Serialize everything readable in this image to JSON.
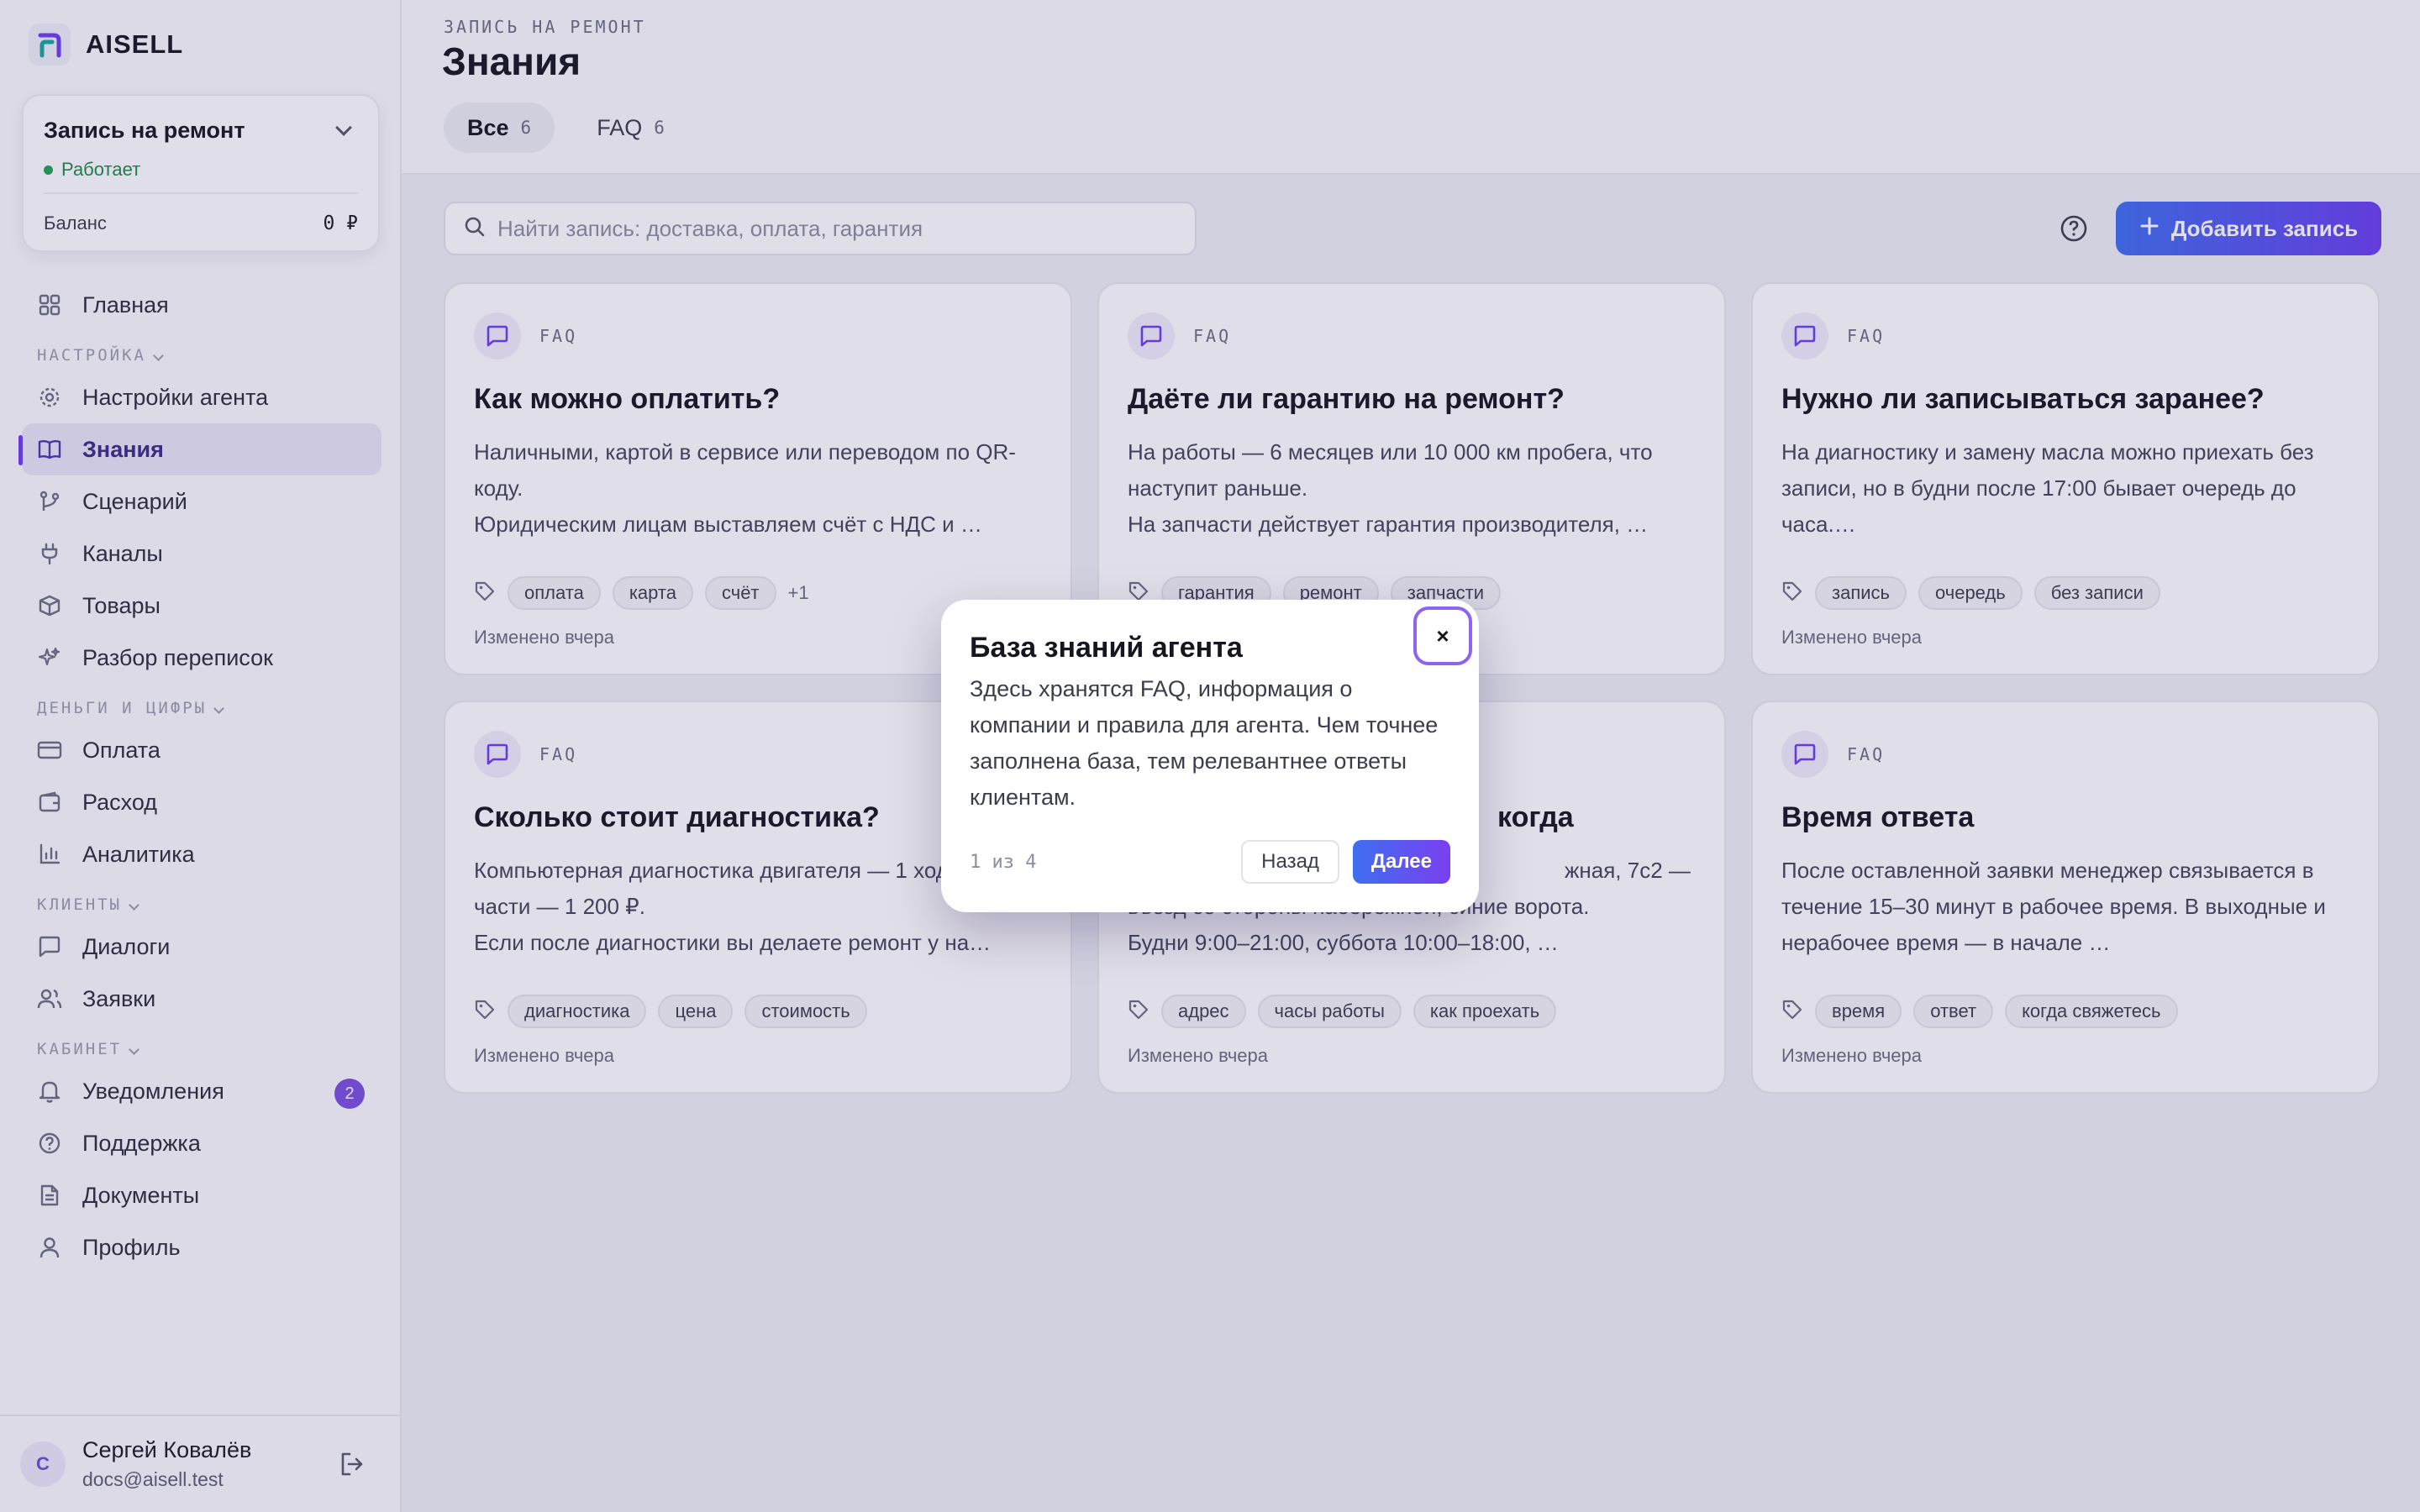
{
  "brand": {
    "name": "AISELL"
  },
  "agent": {
    "name": "Запись на ремонт",
    "status": "Работает",
    "balance_label": "Баланс",
    "balance_value": "0 ₽"
  },
  "nav": {
    "home": "Главная",
    "section_settings": "НАСТРОЙКА",
    "agent_settings": "Настройки агента",
    "knowledge": "Знания",
    "scenarios": "Сценарий",
    "channels": "Каналы",
    "products": "Товары",
    "chat_review": "Разбор переписок",
    "section_money": "ДЕНЬГИ И ЦИФРЫ",
    "payment": "Оплата",
    "expense": "Расход",
    "analytics": "Аналитика",
    "section_clients": "КЛИЕНТЫ",
    "dialogs": "Диалоги",
    "requests": "Заявки",
    "section_cabinet": "КАБИНЕТ",
    "notifications": "Уведомления",
    "notifications_count": "2",
    "support": "Поддержка",
    "documents": "Документы",
    "profile": "Профиль"
  },
  "user": {
    "name": "Сергей Ковалёв",
    "email": "docs@aisell.test",
    "initial": "С"
  },
  "header": {
    "breadcrumb": "ЗАПИСЬ НА РЕМОНТ",
    "title": "Знания",
    "tabs": [
      {
        "label": "Все",
        "count": "6"
      },
      {
        "label": "FAQ",
        "count": "6"
      }
    ]
  },
  "toolbar": {
    "search_placeholder": "Найти запись: доставка, оплата, гарантия",
    "add_label": "Добавить запись"
  },
  "cards": [
    {
      "type": "FAQ",
      "title": "Как можно оплатить?",
      "text": "Наличными, картой в сервисе или переводом по QR-коду.\nЮридическим лицам выставляем счёт с НДС и …",
      "tags": [
        "оплата",
        "карта",
        "счёт"
      ],
      "more": "+1",
      "date": "Изменено вчера"
    },
    {
      "type": "FAQ",
      "title": "Даёте ли гарантию на ремонт?",
      "text": "На работы — 6 месяцев или 10 000 км пробега, что наступит раньше.\nНа запчасти действует гарантия производителя, …",
      "tags": [
        "гарантия",
        "ремонт",
        "запчасти"
      ],
      "more": "",
      "date": ""
    },
    {
      "type": "FAQ",
      "title": "Нужно ли записываться заранее?",
      "text": "На диагностику и замену масла можно приехать без записи, но в будни после 17:00 бывает очередь до часа.…",
      "tags": [
        "запись",
        "очередь",
        "без записи"
      ],
      "more": "",
      "date": "Изменено вчера"
    },
    {
      "type": "FAQ",
      "title": "Сколько стоит диагностика?",
      "text": "Компьютерная диагностика двигателя — 1 ходовой части — 1 200 ₽.\nЕсли после диагностики вы делаете ремонт у на…",
      "tags": [
        "диагностика",
        "цена",
        "стоимость"
      ],
      "more": "",
      "date": "Изменено вчера"
    },
    {
      "type": "",
      "title": "когда",
      "text": "жная, 7с2 — въезд со стороны набережной, синие ворота.\nБудни 9:00–21:00, суббота 10:00–18:00, …",
      "tags": [
        "адрес",
        "часы работы",
        "как проехать"
      ],
      "more": "",
      "date": "Изменено вчера"
    },
    {
      "type": "FAQ",
      "title": "Время ответа",
      "text": "После оставленной заявки менеджер связывается в течение 15–30 минут в рабочее время. В выходные и нерабочее время — в начале …",
      "tags": [
        "время",
        "ответ",
        "когда свяжетесь"
      ],
      "more": "",
      "date": "Изменено вчера"
    }
  ],
  "popover": {
    "title": "База знаний агента",
    "text": "Здесь хранятся FAQ, информация о компании и правила для агента. Чем точнее заполнена база, тем релевантнее ответы клиентам.",
    "close": "×",
    "step": "1 из 4",
    "back": "Назад",
    "next": "Далее"
  },
  "colors": {
    "accent": "#6a3ff0",
    "accent_blue": "#3e6ff0",
    "status_green": "#22a357"
  }
}
